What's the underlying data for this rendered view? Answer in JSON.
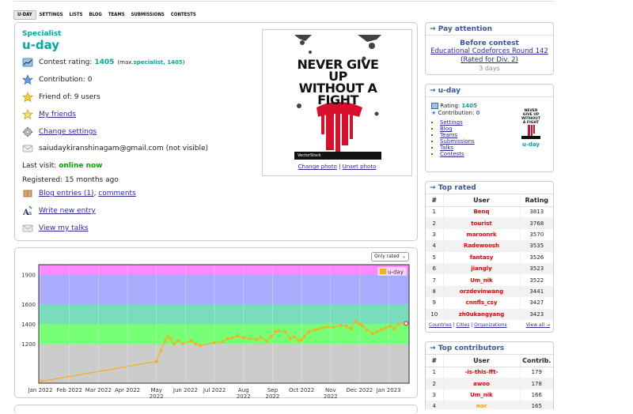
{
  "nav": [
    "U-DAY",
    "SETTINGS",
    "LISTS",
    "BLOG",
    "TEAMS",
    "SUBMISSIONS",
    "CONTESTS"
  ],
  "profile": {
    "rank": "Specialist",
    "handle": "u-day",
    "rating_label": "Contest rating: ",
    "rating": "1405",
    "max_prefix": "(max. ",
    "max_text": "specialist, 1405",
    "max_suffix": ")",
    "contribution": "Contribution: 0",
    "friend_of": "Friend of: 9 users",
    "my_friends": "My friends",
    "change_settings": "Change settings",
    "email": "saiudaykiranshinagam@gmail.com (not visible)",
    "last_visit_label": "Last visit: ",
    "last_visit": "online now",
    "registered": "Registered: 15 months ago",
    "blog_entries": "Blog entries (1)",
    "comments": "comments",
    "write_entry": "Write new entry",
    "view_talks": "View my talks",
    "poster_text": "NEVER GIVE UP WITHOUT A FIGHT",
    "poster_brand": "VectorStock",
    "change_photo": "Change photo",
    "unset_photo": "Unset photo",
    "photo_sep": " | "
  },
  "graph": {
    "only_rated": "Only rated"
  },
  "chart_data": {
    "type": "line",
    "series": [
      {
        "name": "u-day",
        "color": "#f2b322"
      }
    ],
    "x_ticks": [
      "Jan 2022",
      "Feb 2022",
      "Mar 2022",
      "Apr 2022",
      "May 2022",
      "Jun 2022",
      "Jul 2022",
      "Aug 2022",
      "Sep 2022",
      "Oct 2022",
      "Nov 2022",
      "Dec 2022",
      "Jan 2023"
    ],
    "y_ticks": [
      1200,
      1400,
      1600,
      1900
    ],
    "ylim": [
      800,
      2000
    ],
    "bands": [
      {
        "from": 800,
        "to": 1200,
        "color": "#cccccc"
      },
      {
        "from": 1200,
        "to": 1400,
        "color": "#77ff77"
      },
      {
        "from": 1400,
        "to": 1600,
        "color": "#77ddbb"
      },
      {
        "from": 1600,
        "to": 1900,
        "color": "#aaaaff"
      },
      {
        "from": 1900,
        "to": 2000,
        "color": "#ff88ff"
      }
    ],
    "points_month": [
      0.05,
      4.0,
      4.15,
      4.3,
      4.4,
      4.5,
      4.6,
      4.75,
      4.9,
      5.2,
      5.35,
      5.5,
      6.0,
      6.3,
      6.45,
      6.6,
      6.8,
      7.0,
      7.25,
      7.45,
      7.6,
      7.8,
      7.95,
      8.1,
      8.2,
      8.45,
      8.6,
      8.75,
      8.9,
      9.0,
      9.1,
      9.25,
      9.45,
      9.6,
      9.75,
      9.9,
      10.1,
      10.35,
      10.55,
      10.7,
      10.85,
      11.0,
      11.1,
      11.25,
      11.45,
      11.6,
      11.75,
      11.9,
      12.05,
      12.2,
      12.35,
      12.6
    ],
    "points_rating": [
      820,
      1020,
      1130,
      1230,
      1270,
      1250,
      1200,
      1230,
      1200,
      1230,
      1200,
      1180,
      1210,
      1220,
      1250,
      1255,
      1280,
      1260,
      1250,
      1240,
      1265,
      1225,
      1270,
      1320,
      1330,
      1320,
      1250,
      1270,
      1230,
      1240,
      1275,
      1320,
      1340,
      1350,
      1360,
      1370,
      1365,
      1385,
      1380,
      1350,
      1430,
      1400,
      1380,
      1340,
      1300,
      1320,
      1340,
      1360,
      1380,
      1350,
      1400,
      1405
    ]
  },
  "pay": {
    "title": "Pay attention",
    "heading": "Before contest",
    "contest_line1": "Educational Codeforces Round 142",
    "contest_line2": "(Rated for Div. 2)",
    "days": "3 days"
  },
  "mini": {
    "title": "u-day",
    "rating_label": "Rating: ",
    "rating": "1405",
    "contribution_label": "Contribution: ",
    "contribution": "0",
    "links": [
      "Settings",
      "Blog",
      "Teams",
      "Submissions",
      "Talks",
      "Contests"
    ],
    "handle": "u-day"
  },
  "top_rated": {
    "title": "Top rated",
    "headers": [
      "#",
      "User",
      "Rating"
    ],
    "rows": [
      [
        "1",
        "Benq",
        "3813"
      ],
      [
        "2",
        "tourist",
        "3768"
      ],
      [
        "3",
        "maroonrk",
        "3570"
      ],
      [
        "4",
        "Radewoosh",
        "3535"
      ],
      [
        "5",
        "fantasy",
        "3526"
      ],
      [
        "6",
        "jiangly",
        "3523"
      ],
      [
        "7",
        "Um_nik",
        "3522"
      ],
      [
        "8",
        "orzdevinwang",
        "3441"
      ],
      [
        "9",
        "cnnfls_csy",
        "3427"
      ],
      [
        "10",
        "zh0ukangyang",
        "3423"
      ]
    ],
    "footer_links": [
      "Countries",
      "Cities",
      "Organizations"
    ],
    "view_all": "View all →"
  },
  "top_contrib": {
    "title": "Top contributors",
    "headers": [
      "#",
      "User",
      "Contrib."
    ],
    "rows": [
      [
        "1",
        "-is-this-fft-",
        "179"
      ],
      [
        "2",
        "awoo",
        "178"
      ],
      [
        "3",
        "Um_nik",
        "166"
      ],
      [
        "4",
        "nor",
        "165"
      ]
    ]
  }
}
